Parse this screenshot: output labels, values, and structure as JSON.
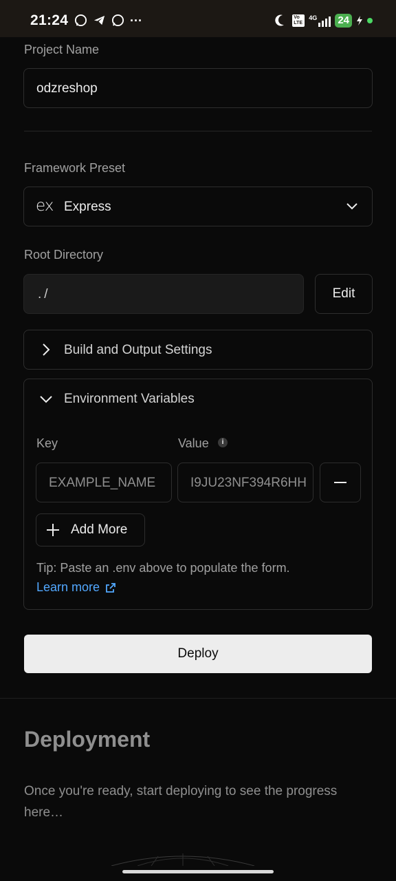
{
  "status_bar": {
    "time": "21:24",
    "left_icons": [
      "whatsapp-business-icon",
      "telegram-icon",
      "whatsapp-icon",
      "more-dots-icon"
    ],
    "more": "···",
    "right_icons": [
      "moon-icon",
      "volte-icon",
      "4g-signal-icon",
      "battery-icon",
      "charging-icon"
    ],
    "battery": "24",
    "volte": "Vo LTE",
    "network": "4G"
  },
  "project": {
    "name_label": "Project Name",
    "name_value": "odzreshop"
  },
  "framework": {
    "label": "Framework Preset",
    "logo": "ex",
    "value": "Express"
  },
  "root": {
    "label": "Root Directory",
    "value": "./",
    "edit_label": "Edit"
  },
  "build": {
    "label": "Build and Output Settings"
  },
  "env": {
    "label": "Environment Variables",
    "key_header": "Key",
    "value_header": "Value",
    "key_placeholder": "EXAMPLE_NAME",
    "value_placeholder": "I9JU23NF394R6HH",
    "add_more_label": "Add More",
    "tip": "Tip: Paste an .env above to populate the form.",
    "learn_more": "Learn more"
  },
  "deploy_button": "Deploy",
  "deployment": {
    "title": "Deployment",
    "description_line1": "Once you're ready, start deploying to see the progress",
    "description_line2": "here…"
  },
  "colors": {
    "background": "#0a0a0a",
    "border": "#2e2e2e",
    "link": "#52a8ff",
    "deploy_bg": "#ededed",
    "battery": "#4caf50"
  }
}
